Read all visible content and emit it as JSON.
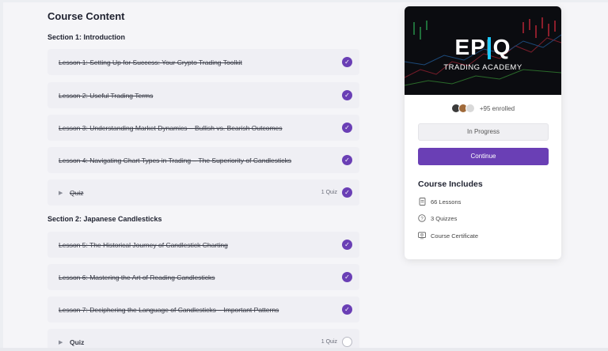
{
  "course_content": {
    "title": "Course Content",
    "sections": [
      {
        "title": "Section 1: Introduction",
        "items": [
          {
            "label": "Lesson 1: Setting Up for Success: Your Crypto Trading Toolkit",
            "done": true
          },
          {
            "label": "Lesson 2: Useful Trading Terms",
            "done": true
          },
          {
            "label": "Lesson 3: Understanding Market Dynamics – Bullish vs. Bearish Outcomes",
            "done": true
          },
          {
            "label": "Lesson 4: Navigating Chart Types in Trading – The Superiority of Candlesticks",
            "done": true
          },
          {
            "label": "Quiz",
            "count": "1 Quiz",
            "done": true
          }
        ]
      },
      {
        "title": "Section 2: Japanese Candlesticks",
        "items": [
          {
            "label": "Lesson 5: The Historical Journey of Candlestick Charting",
            "done": true
          },
          {
            "label": "Lesson 6: Mastering the Art of Reading Candlesticks",
            "done": true
          },
          {
            "label": "Lesson 7: Deciphering the Language of Candlesticks – Important Patterns",
            "done": true
          },
          {
            "label": "Quiz",
            "count": "1 Quiz",
            "done": false
          }
        ]
      }
    ]
  },
  "card": {
    "logo_text": "EPIQ",
    "logo_subtitle": "TRADING ACADEMY",
    "enrolled": "+95 enrolled",
    "status": "In Progress",
    "continue_label": "Continue",
    "includes_title": "Course Includes",
    "includes": [
      {
        "icon": "document-icon",
        "text": "66 Lessons"
      },
      {
        "icon": "question-circle-icon",
        "text": "3 Quizzes"
      },
      {
        "icon": "certificate-icon",
        "text": "Course Certificate"
      }
    ]
  },
  "colors": {
    "accent": "#6a3fb5",
    "item_bg": "#efeff4",
    "logo_accent": "#1ec9ff"
  }
}
